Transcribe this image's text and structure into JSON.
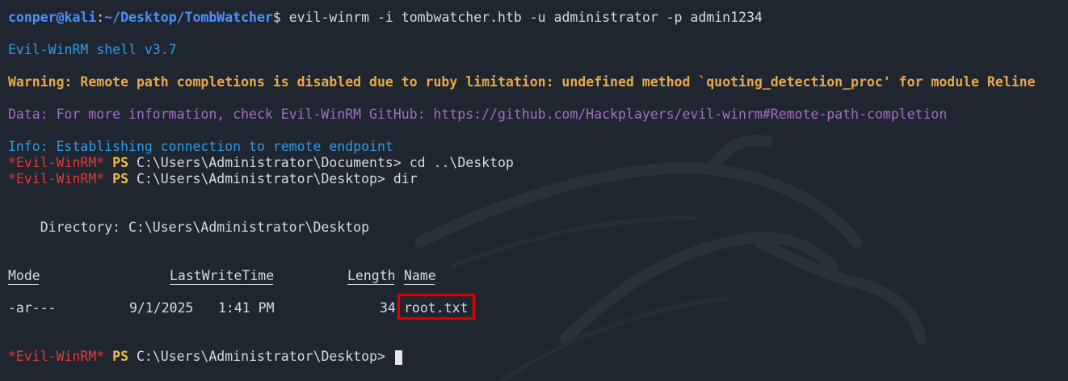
{
  "line1": {
    "user": "conper",
    "at": "@",
    "host": "kali",
    "sep": ":",
    "path": "~/Desktop/TombWatcher",
    "symbol": "$",
    "command": " evil-winrm -i tombwatcher.htb -u administrator -p admin1234"
  },
  "banner": "Evil-WinRM shell v3.7",
  "warning": "Warning: Remote path completions is disabled due to ruby limitation: undefined method `quoting_detection_proc' for module Reline",
  "data_line": "Data: For more information, check Evil-WinRM GitHub: https://github.com/Hackplayers/evil-winrm#Remote-path-completion",
  "info": "Info: Establishing connection to remote endpoint",
  "ps1": {
    "evil": "*Evil-WinRM*",
    "ps": "PS",
    "path": "C:\\Users\\Administrator\\Documents>",
    "command": " cd ..\\Desktop"
  },
  "ps2": {
    "evil": "*Evil-WinRM*",
    "ps": "PS",
    "path": "C:\\Users\\Administrator\\Desktop>",
    "command": " dir"
  },
  "directory": "    Directory: C:\\Users\\Administrator\\Desktop",
  "table": {
    "headers": {
      "mode": "Mode",
      "lastwrite": "LastWriteTime",
      "length": "Length",
      "name": "Name"
    },
    "row": {
      "mode": "-ar---",
      "date": "9/1/2025",
      "time": "1:41 PM",
      "length": "34",
      "name": "root.txt"
    }
  },
  "ps3": {
    "evil": "*Evil-WinRM*",
    "ps": "PS",
    "path": "C:\\Users\\Administrator\\Desktop>"
  },
  "colors": {
    "background": "#20262f",
    "prompt_blue": "#4d8fff",
    "info_blue": "#2e9be8",
    "warning_orange": "#e8a84a",
    "data_purple": "#a56ec4",
    "evil_red": "#e33a3a",
    "ps_yellow": "#f0c040",
    "highlight_red": "#e00000"
  }
}
